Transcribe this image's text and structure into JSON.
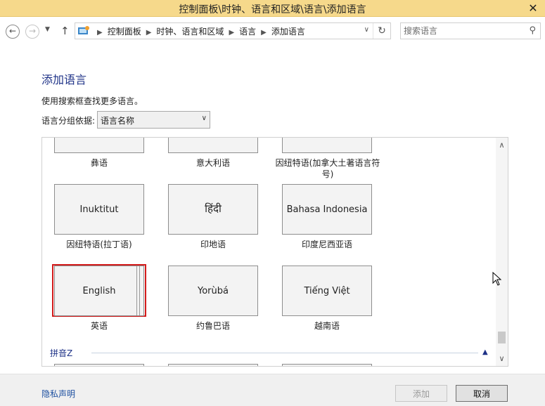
{
  "window": {
    "title": "控制面板\\时钟、语言和区域\\语言\\添加语言",
    "close_glyph": "✕"
  },
  "nav": {
    "breadcrumbs": [
      "控制面板",
      "时钟、语言和区域",
      "语言",
      "添加语言"
    ],
    "search_placeholder": "搜索语言"
  },
  "page": {
    "heading": "添加语言",
    "description": "使用搜索框查找更多语言。",
    "group_label": "语言分组依据:",
    "group_value": "语言名称"
  },
  "languages": {
    "top_row": [
      "彝语",
      "意大利语",
      "因纽特语(加拿大土著语言符号)"
    ],
    "row2": [
      {
        "native": "Inuktitut",
        "name": "因纽特语(拉丁语)"
      },
      {
        "native": "हिंदी",
        "name": "印地语"
      },
      {
        "native": "Bahasa Indonesia",
        "name": "印度尼西亚语"
      }
    ],
    "row3": [
      {
        "native": "English",
        "name": "英语",
        "selected": true
      },
      {
        "native": "Yorùbá",
        "name": "约鲁巴语"
      },
      {
        "native": "Tiếng Việt",
        "name": "越南语"
      }
    ],
    "group_header": "拼音Z"
  },
  "footer": {
    "privacy_link": "隐私声明",
    "add_button": "添加",
    "cancel_button": "取消"
  },
  "colors": {
    "titlebar": "#f6d98b",
    "heading": "#1e3287",
    "selection": "#d31a1a"
  }
}
